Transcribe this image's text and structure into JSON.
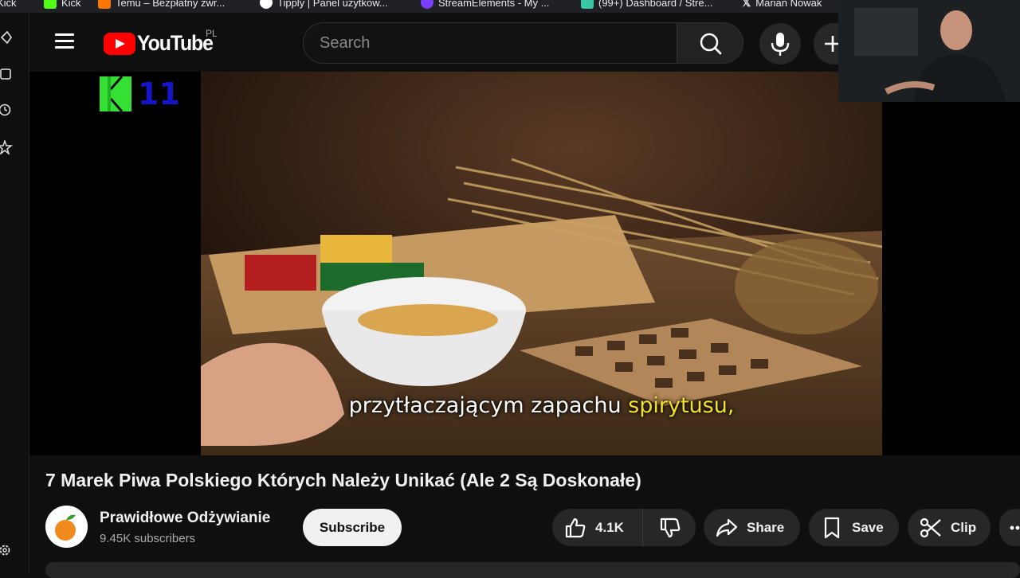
{
  "browser_tabs": [
    {
      "label": "Kick",
      "icon": "kick-favicon",
      "color": "#53fc18"
    },
    {
      "label": "Kick",
      "icon": "kick-favicon",
      "color": "#53fc18"
    },
    {
      "label": "Temu – Bezpłatny zwr...",
      "icon": "temu-favicon",
      "color": "#fb7701"
    },
    {
      "label": "Tipply | Panel użytkow...",
      "icon": "tipply-favicon",
      "color": "#ffffff"
    },
    {
      "label": "StreamElements - My ...",
      "icon": "streamelements-favicon",
      "color": "#7a3cff"
    },
    {
      "label": "(99+) Dashboard / Stre...",
      "icon": "twitch-favicon",
      "color": "#38c6a4"
    },
    {
      "label": "Marian Nowak",
      "icon": "x-favicon",
      "color": "#ffffff"
    }
  ],
  "header": {
    "logo_text": "YouTube",
    "country_code": "PL",
    "search_placeholder": "Search"
  },
  "video": {
    "overlay_logo_letter": "K",
    "overlay_logo_number": "11",
    "subtitle_main": "przytłaczającym zapachu ",
    "subtitle_highlight": "spirytusu,"
  },
  "info": {
    "title": "7 Marek Piwa Polskiego Których Należy Unikać (Ale 2 Są Doskonałe)",
    "channel_name": "Prawidłowe Odżywianie",
    "subscribers": "9.45K subscribers",
    "subscribe_label": "Subscribe",
    "like_count": "4.1K",
    "share_label": "Share",
    "save_label": "Save",
    "clip_label": "Clip"
  },
  "colors": {
    "brand_red": "#ff0000",
    "background": "#0f0f0f",
    "pill": "#272727",
    "subtitle_highlight": "#f3e22a"
  }
}
